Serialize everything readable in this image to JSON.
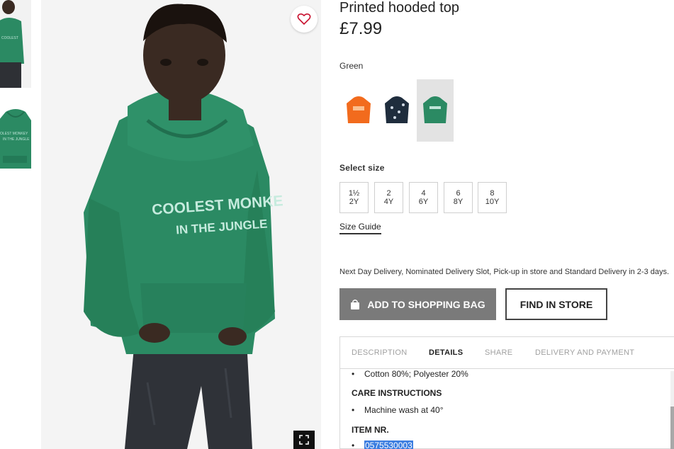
{
  "product": {
    "title": "Printed hooded top",
    "price": "£7.99",
    "color_name": "Green",
    "hoodie_print_line1": "COOLEST MONKE",
    "hoodie_print_line2": "IN THE JUNGLE",
    "thumb_print": "COOLEST MONKEY IN THE JUNGLE"
  },
  "swatches": [
    {
      "color": "#f26b1d",
      "icon": "orange-hoodie-icon"
    },
    {
      "color": "#1f2d3d",
      "icon": "navy-print-hoodie-icon"
    },
    {
      "color": "#2b8a63",
      "icon": "green-hoodie-icon",
      "selected": true
    }
  ],
  "sizes": {
    "label": "Select size",
    "options": [
      {
        "line1": "1½",
        "line2": "2Y"
      },
      {
        "line1": "2",
        "line2": "4Y"
      },
      {
        "line1": "4",
        "line2": "6Y"
      },
      {
        "line1": "6",
        "line2": "8Y"
      },
      {
        "line1": "8",
        "line2": "10Y"
      }
    ],
    "guide_label": "Size Guide"
  },
  "delivery_text": "Next Day Delivery, Nominated Delivery Slot, Pick-up in store and Standard Delivery in 2-3 days.",
  "actions": {
    "add_to_bag": "ADD TO SHOPPING BAG",
    "find_in_store": "FIND IN STORE"
  },
  "tabs": [
    "DESCRIPTION",
    "DETAILS",
    "SHARE",
    "DELIVERY AND PAYMENT"
  ],
  "active_tab": "DETAILS",
  "details": {
    "composition": "Cotton 80%; Polyester 20%",
    "care_heading": "CARE INSTRUCTIONS",
    "care_item": "Machine wash at 40°",
    "item_heading": "ITEM NR.",
    "item_number": "0575530003"
  },
  "colors": {
    "hoodie_green": "#2b8a63",
    "add_button_bg": "#7a7a7a",
    "selection_highlight": "#3b7de0"
  }
}
